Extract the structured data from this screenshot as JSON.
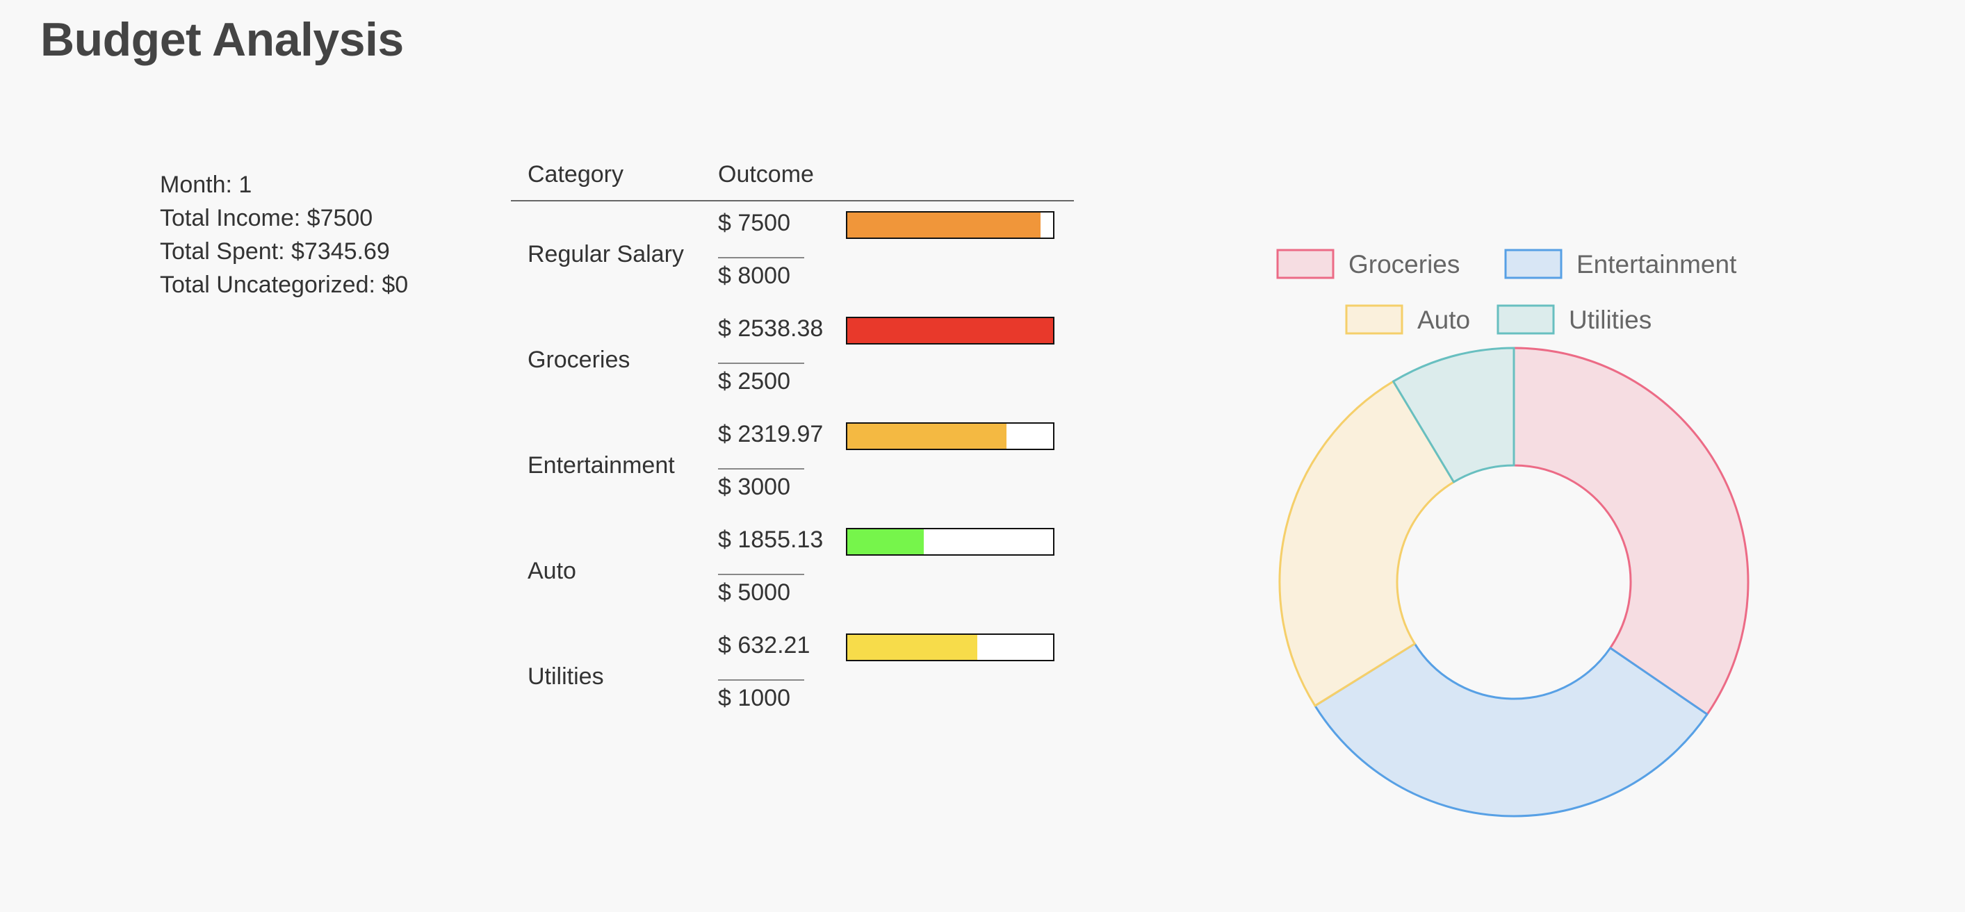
{
  "page": {
    "title": "Budget Analysis"
  },
  "summary": {
    "month": "Month: 1",
    "total_income": "Total Income: $7500",
    "total_spent": "Total Spent: $7345.69",
    "total_uncategorized": "Total Uncategorized: $0"
  },
  "table": {
    "headers": {
      "category": "Category",
      "outcome": "Outcome"
    },
    "rows": [
      {
        "category": "Regular Salary",
        "actual": "$ 7500",
        "budget": "$ 8000",
        "progress": 0.9375,
        "bar_color": "#f0963a"
      },
      {
        "category": "Groceries",
        "actual": "$ 2538.38",
        "budget": "$ 2500",
        "progress": 1.0,
        "bar_color": "#e8392b"
      },
      {
        "category": "Entertainment",
        "actual": "$ 2319.97",
        "budget": "$ 3000",
        "progress": 0.7733,
        "bar_color": "#f4b942"
      },
      {
        "category": "Auto",
        "actual": "$ 1855.13",
        "budget": "$ 5000",
        "progress": 0.371,
        "bar_color": "#76f54b"
      },
      {
        "category": "Utilities",
        "actual": "$ 632.21",
        "budget": "$ 1000",
        "progress": 0.6322,
        "bar_color": "#f7dc4a"
      }
    ]
  },
  "chart_data": {
    "type": "pie",
    "donut": true,
    "categories": [
      "Groceries",
      "Entertainment",
      "Auto",
      "Utilities"
    ],
    "values": [
      2538.38,
      2319.97,
      1855.13,
      632.21
    ],
    "colors": [
      {
        "border": "#ec6b86",
        "fill": "#f6dde2"
      },
      {
        "border": "#57a0e5",
        "fill": "#d8e6f5"
      },
      {
        "border": "#f5cf6a",
        "fill": "#faf0dc"
      },
      {
        "border": "#68bfc0",
        "fill": "#dcecec"
      }
    ],
    "legend_position": "top",
    "title": ""
  }
}
